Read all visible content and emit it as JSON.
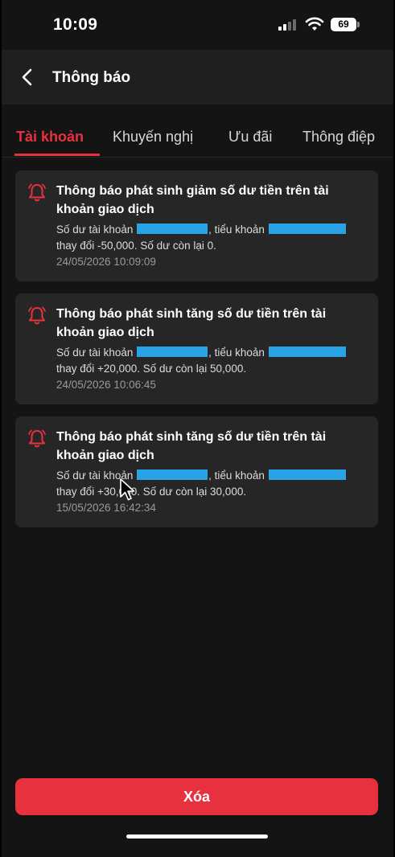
{
  "status_bar": {
    "time": "10:09",
    "battery": "69",
    "icons": [
      "signal-icon",
      "wifi-icon",
      "battery-icon"
    ]
  },
  "header": {
    "back_icon": "chevron-left-icon",
    "title": "Thông báo"
  },
  "tabs": [
    {
      "label": "Tài khoản",
      "active": true
    },
    {
      "label": "Khuyến nghị",
      "active": false
    },
    {
      "label": "Ưu đãi",
      "active": false
    },
    {
      "label": "Thông điệp",
      "active": false
    }
  ],
  "notifications": [
    {
      "icon": "bell-icon",
      "title": "Thông báo phát sinh giảm số dư tiền trên tài khoản giao dịch",
      "body_prefix": "Số dư tài khoản",
      "body_middle": ", tiểu khoản",
      "body_suffix": "thay đổi -50,000. Số dư còn lại 0.",
      "time": "24/05/2026 10:09:09"
    },
    {
      "icon": "bell-icon",
      "title": "Thông báo phát sinh tăng số dư tiền trên tài khoản giao dịch",
      "body_prefix": "Số dư tài khoản",
      "body_middle": ", tiểu khoản",
      "body_suffix": "thay đổi +20,000. Số dư còn lại 50,000.",
      "time": "24/05/2026 10:06:45"
    },
    {
      "icon": "bell-icon",
      "title": "Thông báo phát sinh tăng số dư tiền trên tài khoản giao dịch",
      "body_prefix": "Số dư tài khoản",
      "body_middle": ", tiểu khoản",
      "body_suffix": "thay đổi +30,000. Số dư còn lại 30,000.",
      "time": "15/05/2026 16:42:34"
    }
  ],
  "footer": {
    "delete_label": "Xóa"
  },
  "colors": {
    "accent": "#e8313f",
    "redaction": "#2aa3e6",
    "card_bg": "#262626",
    "page_bg": "#141414"
  }
}
